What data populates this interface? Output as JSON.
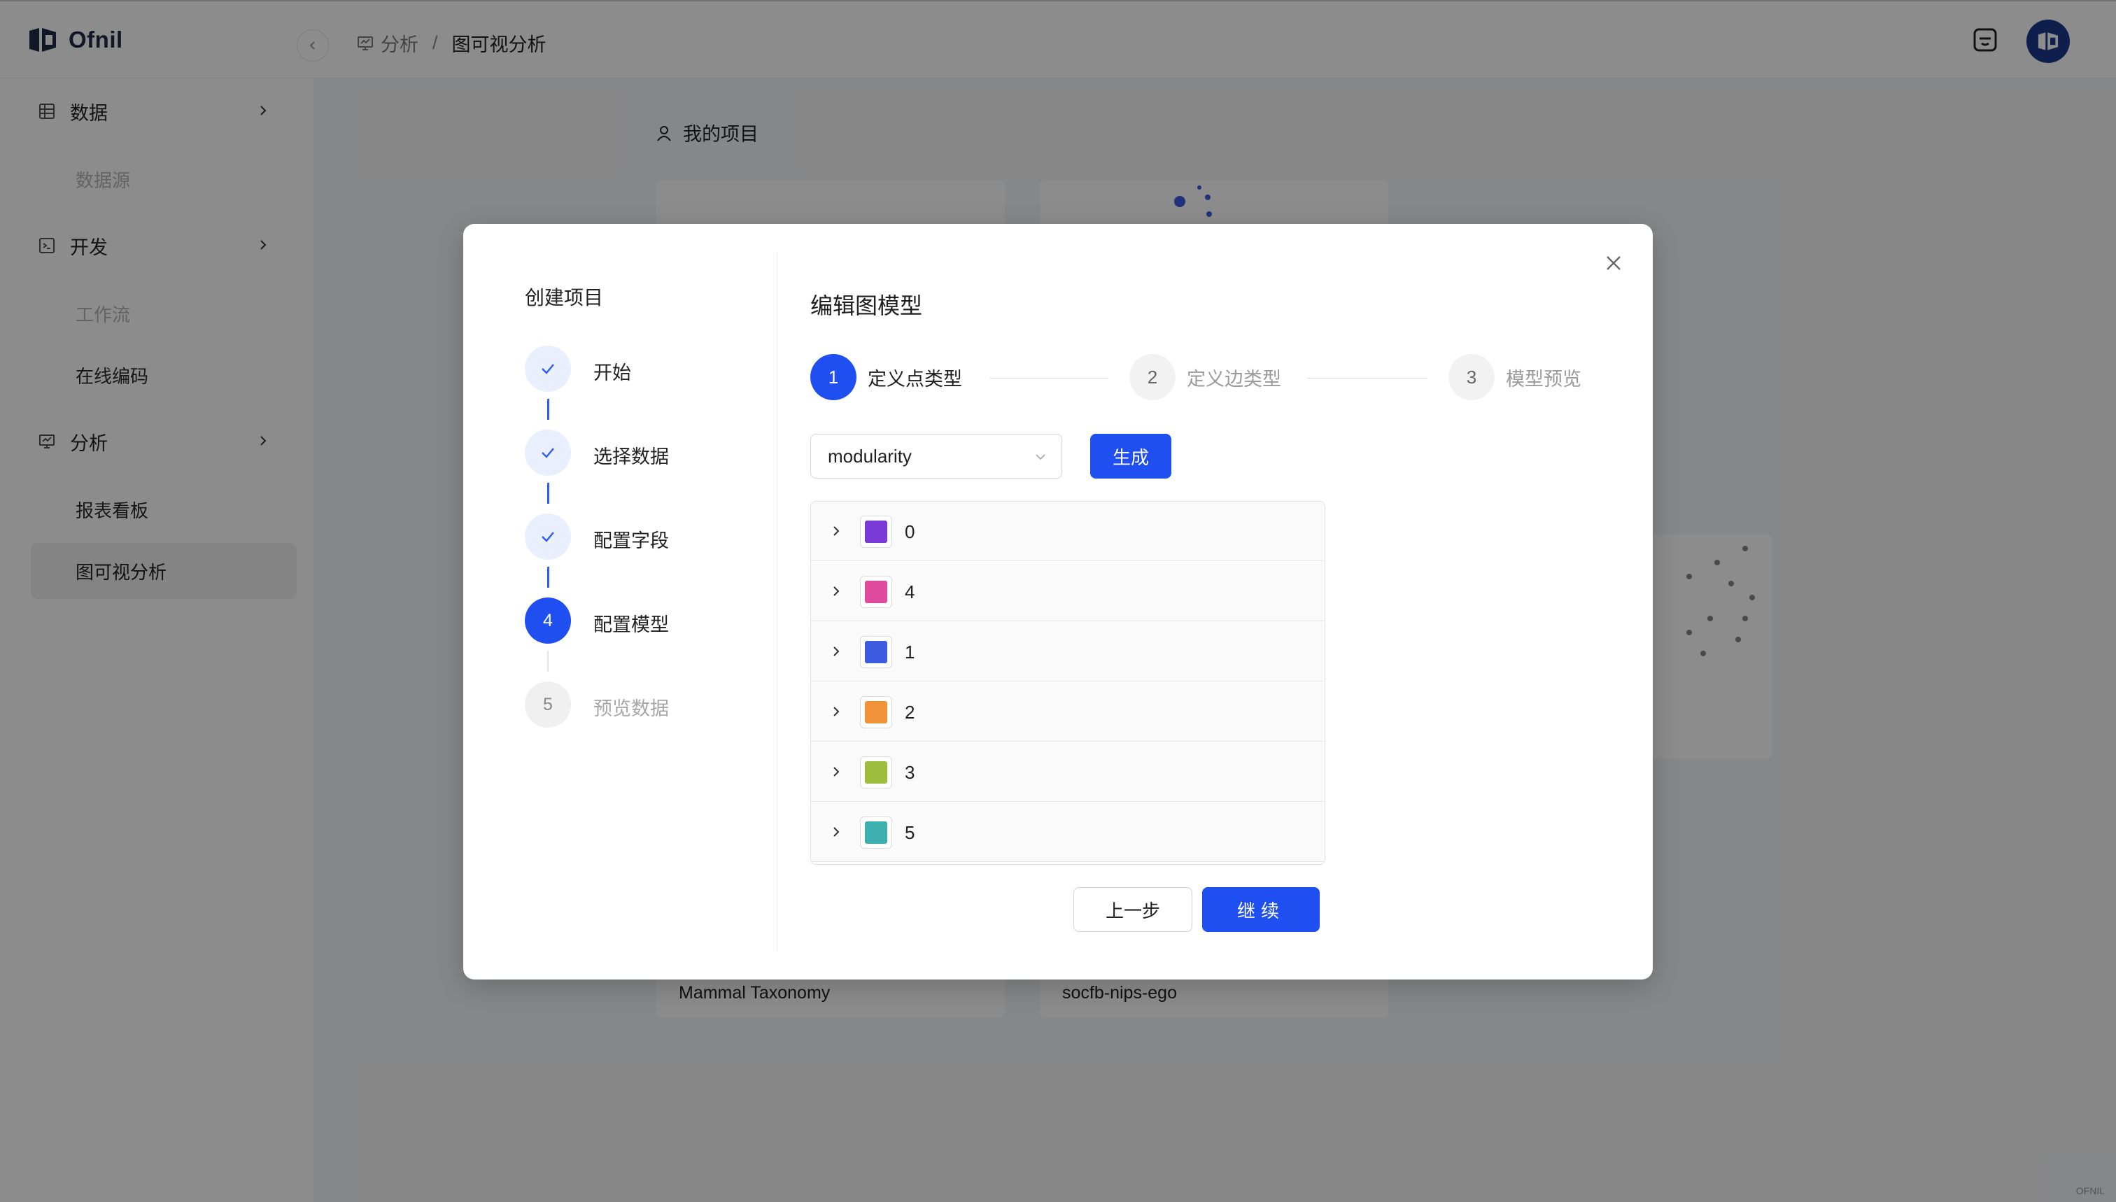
{
  "app": {
    "logo_text": "Ofnil",
    "breadcrumb": [
      "分析",
      "图可视分析"
    ],
    "breadcrumb_sep": "/",
    "watermark": "OFNIL"
  },
  "sidebar": {
    "groups": [
      {
        "label": "数据",
        "icon": "database-icon"
      },
      {
        "label": "开发",
        "icon": "terminal-icon"
      },
      {
        "label": "分析",
        "icon": "monitor-chart-icon"
      }
    ],
    "items": [
      {
        "label": "数据源",
        "state": "muted"
      },
      {
        "label": "工作流",
        "state": "muted"
      },
      {
        "label": "在线编码",
        "state": "normal"
      },
      {
        "label": "报表看板",
        "state": "normal"
      },
      {
        "label": "图可视分析",
        "state": "active"
      }
    ]
  },
  "main": {
    "section_title": "我的项目",
    "cards": [
      {
        "title": "Mammal Taxonomy"
      },
      {
        "title": "socfb-nips-ego"
      }
    ]
  },
  "modal": {
    "left_title": "创建项目",
    "steps": [
      {
        "num": "1",
        "label": "开始",
        "status": "done"
      },
      {
        "num": "2",
        "label": "选择数据",
        "status": "done"
      },
      {
        "num": "3",
        "label": "配置字段",
        "status": "done"
      },
      {
        "num": "4",
        "label": "配置模型",
        "status": "current"
      },
      {
        "num": "5",
        "label": "预览数据",
        "status": "wait"
      }
    ],
    "title": "编辑图模型",
    "substeps": [
      {
        "num": "1",
        "label": "定义点类型",
        "status": "current"
      },
      {
        "num": "2",
        "label": "定义边类型",
        "status": "wait"
      },
      {
        "num": "3",
        "label": "模型预览",
        "status": "wait"
      }
    ],
    "select_value": "modularity",
    "generate_label": "生成",
    "node_types": [
      {
        "name": "0",
        "color": "#7a3ad8",
        "enabled": true
      },
      {
        "name": "4",
        "color": "#e04a9c",
        "enabled": true
      },
      {
        "name": "1",
        "color": "#3d5be0",
        "enabled": true
      },
      {
        "name": "2",
        "color": "#f0923a",
        "enabled": true
      },
      {
        "name": "3",
        "color": "#9cbe3c",
        "enabled": true
      },
      {
        "name": "5",
        "color": "#3fb0b0",
        "enabled": true
      }
    ],
    "prev_label": "上一步",
    "next_label": "继续"
  },
  "colors": {
    "primary": "#1f4ff0",
    "overlay": "rgba(0,0,0,0.45)"
  }
}
